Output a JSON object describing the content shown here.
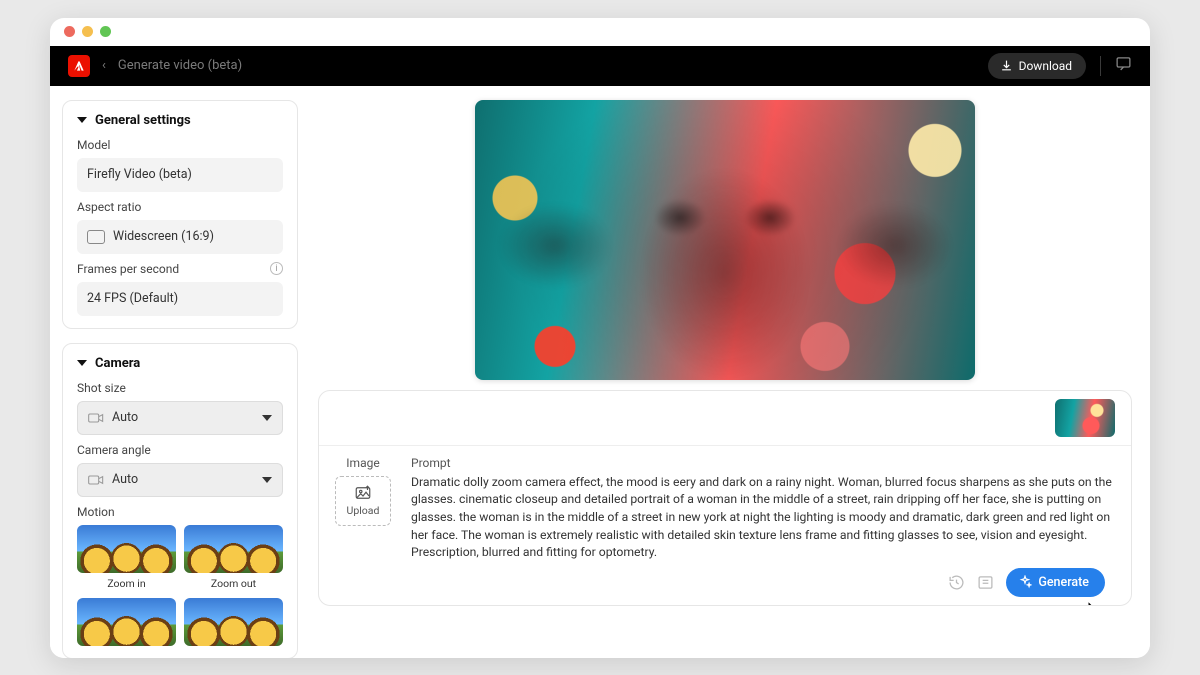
{
  "header": {
    "breadcrumb_title": "Generate video (beta)",
    "download_label": "Download"
  },
  "sidebar": {
    "general": {
      "title": "General settings",
      "model_label": "Model",
      "model_value": "Firefly Video (beta)",
      "aspect_label": "Aspect ratio",
      "aspect_value": "Widescreen (16:9)",
      "fps_label": "Frames per second",
      "fps_value": "24 FPS (Default)"
    },
    "camera": {
      "title": "Camera",
      "shot_label": "Shot size",
      "shot_value": "Auto",
      "angle_label": "Camera angle",
      "angle_value": "Auto",
      "motion_label": "Motion",
      "motion_items": [
        "Zoom in",
        "Zoom out"
      ]
    }
  },
  "prompt_area": {
    "image_label": "Image",
    "upload_label": "Upload",
    "prompt_label": "Prompt",
    "prompt_text": "Dramatic dolly zoom camera effect, the mood is eery and dark on a rainy night. Woman, blurred focus sharpens as she puts on the glasses. cinematic closeup and detailed portrait of a woman in the middle of a street, rain dripping off her face, she is putting on glasses. the woman is in the middle of a street in new york at night the lighting is moody and dramatic, dark green and red light on her face. The woman is extremely realistic with detailed skin texture lens frame and fitting glasses to see, vision and eyesight. Prescription, blurred and fitting for optometry.",
    "generate_label": "Generate"
  },
  "colors": {
    "accent": "#2680eb",
    "adobe_red": "#eb1000"
  }
}
